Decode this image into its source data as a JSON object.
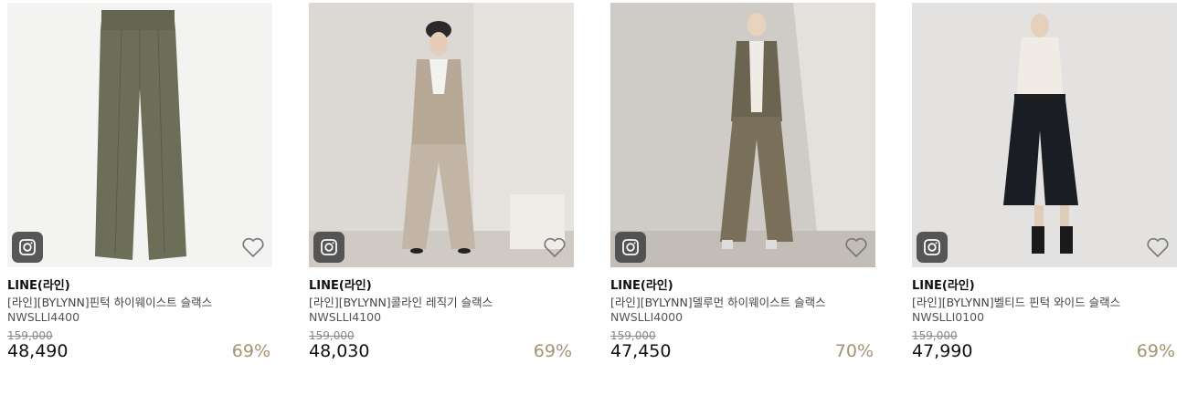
{
  "products": [
    {
      "brand": "LINE(라인)",
      "name": "[라인][BYLYNN]핀턱 하이웨이스트 슬랙스",
      "code": "NWSLLI4400",
      "original_price": "159,000",
      "price": "48,490",
      "discount": "69%"
    },
    {
      "brand": "LINE(라인)",
      "name": "[라인][BYLYNN]콜라인 레직기 슬랙스",
      "code": "NWSLLI4100",
      "original_price": "159,000",
      "price": "48,030",
      "discount": "69%"
    },
    {
      "brand": "LINE(라인)",
      "name": "[라인][BYLYNN]델루먼 하이웨이스트 슬랙스",
      "code": "NWSLLI4000",
      "original_price": "159,000",
      "price": "47,450",
      "discount": "70%"
    },
    {
      "brand": "LINE(라인)",
      "name": "[라인][BYLYNN]벨티드 핀턱 와이드 슬랙스",
      "code": "NWSLLI0100",
      "original_price": "159,000",
      "price": "47,990",
      "discount": "69%"
    }
  ],
  "icons": {
    "instagram": "instagram-icon",
    "wishlist": "heart-outline-icon"
  },
  "colors": {
    "discount": "#a39472",
    "insta_badge": "#4a4a4a"
  }
}
